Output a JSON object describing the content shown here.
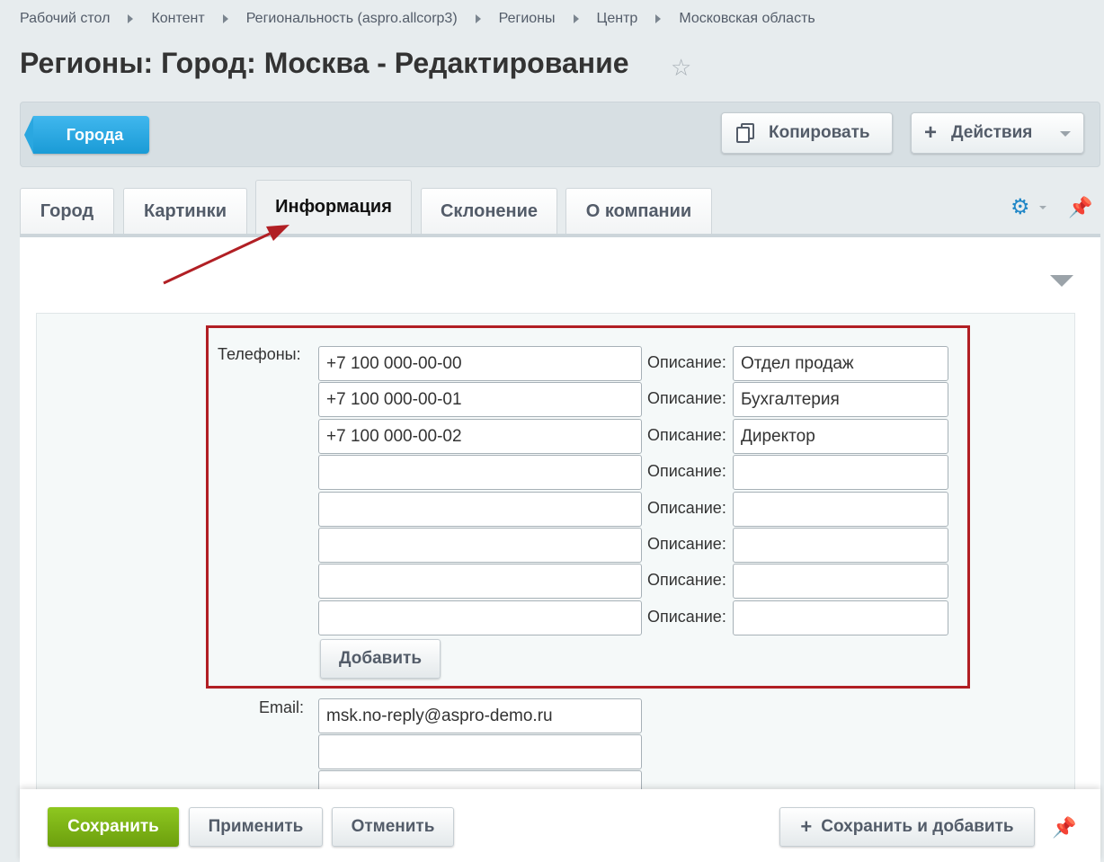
{
  "breadcrumb": [
    "Рабочий стол",
    "Контент",
    "Региональность (aspro.allcorp3)",
    "Регионы",
    "Центр",
    "Московская область"
  ],
  "page_title": "Регионы: Город: Москва - Редактирование",
  "toolbar": {
    "back_label": "Города",
    "copy_label": "Копировать",
    "actions_label": "Действия"
  },
  "tabs": [
    "Город",
    "Картинки",
    "Информация",
    "Склонение",
    "О компании"
  ],
  "active_tab": "Информация",
  "form": {
    "phones_label": "Телефоны:",
    "description_label": "Описание:",
    "phones": [
      {
        "value": "+7 100 000-00-00",
        "description": "Отдел продаж"
      },
      {
        "value": "+7 100 000-00-01",
        "description": "Бухгалтерия"
      },
      {
        "value": "+7 100 000-00-02",
        "description": "Директор"
      },
      {
        "value": "",
        "description": ""
      },
      {
        "value": "",
        "description": ""
      },
      {
        "value": "",
        "description": ""
      },
      {
        "value": "",
        "description": ""
      },
      {
        "value": "",
        "description": ""
      }
    ],
    "add_label": "Добавить",
    "email_label": "Email:",
    "emails": [
      "msk.no-reply@aspro-demo.ru",
      "",
      ""
    ]
  },
  "footer": {
    "save": "Сохранить",
    "apply": "Применить",
    "cancel": "Отменить",
    "save_add": "Сохранить и добавить"
  },
  "colors": {
    "accent_blue": "#1a9bd6",
    "save_green": "#7ab214",
    "highlight_red": "#b11f24"
  }
}
